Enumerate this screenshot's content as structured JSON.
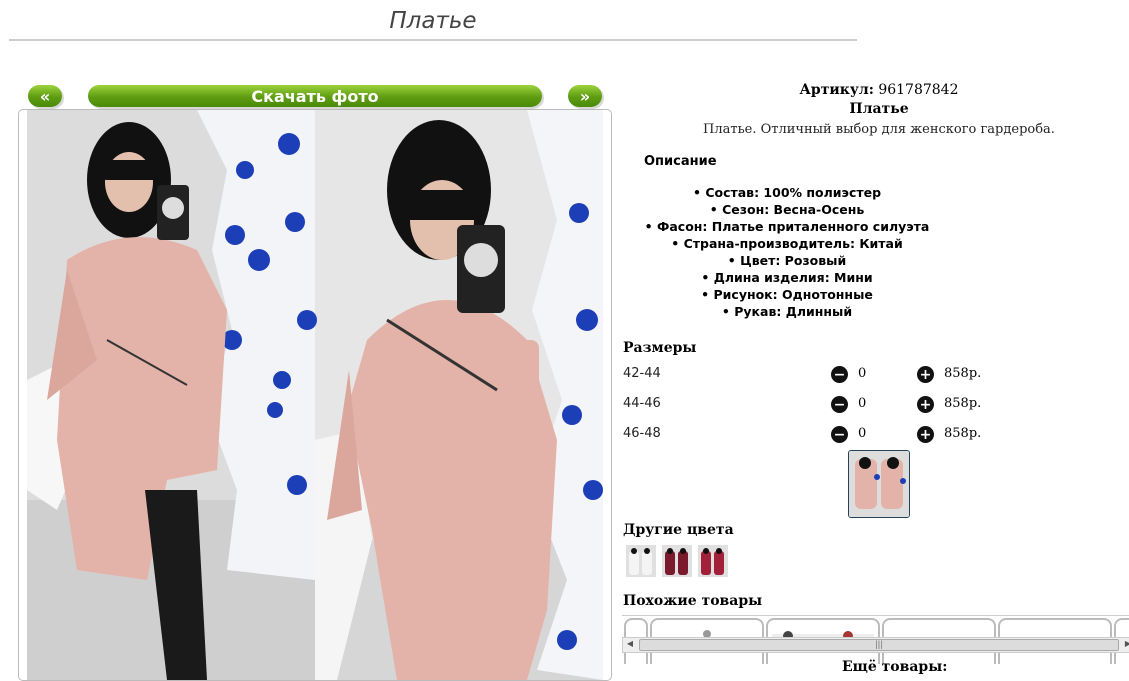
{
  "page": {
    "title": "Платье"
  },
  "gallery": {
    "prev_label": "«",
    "download_label": "Скачать фото",
    "next_label": "»"
  },
  "product": {
    "article_label": "Артикул:",
    "article_value": "961787842",
    "name": "Платье",
    "short_description": "Платье. Отличный выбор для женского гардероба.",
    "description_heading": "Описание",
    "specs": [
      "Состав: 100% полиэстер",
      "Сезон: Весна-Осень",
      "Фасон: Платье приталенного силуэта",
      "Страна-производитель: Китай",
      "Цвет: Розовый",
      "Длина изделия: Мини",
      "Рисунок: Однотонные",
      "Рукав: Длинный"
    ]
  },
  "sizes": {
    "heading": "Размеры",
    "rows": [
      {
        "size": "42-44",
        "qty": "0",
        "price": "858р."
      },
      {
        "size": "44-46",
        "qty": "0",
        "price": "858р."
      },
      {
        "size": "46-48",
        "qty": "0",
        "price": "858р."
      }
    ],
    "minus_symbol": "−",
    "plus_symbol": "+"
  },
  "other_colors": {
    "heading": "Другие цвета",
    "items": [
      "white",
      "burgundy",
      "red"
    ]
  },
  "similar": {
    "heading": "Похожие товары",
    "scroll_grip": "|||"
  },
  "more": {
    "heading": "Ещё товары:"
  },
  "colors": {
    "button_green": "#5e9c12",
    "dress_pink": "#e3b2a8",
    "tree_blue": "#1c3fb8",
    "text_gray": "#444444"
  },
  "icons": [
    "minus-circle-icon",
    "plus-circle-icon",
    "chevron-left-double-icon",
    "chevron-right-double-icon"
  ]
}
